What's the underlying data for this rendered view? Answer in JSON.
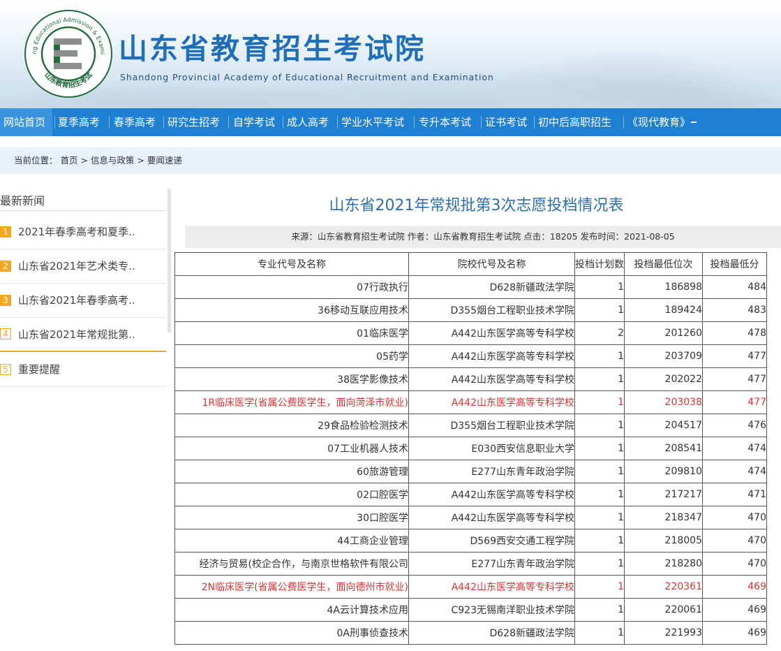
{
  "header": {
    "title": "山东省教育招生考试院",
    "subtitle": "Shandong Provincial Academy of Educational Recruitment and Examination",
    "logo": {
      "ring_text_en": "Shandong Educational Admission & Examinations",
      "ring_text_cn": "山东教育招生考试",
      "letter": "E",
      "icon": "academy-seal-logo"
    }
  },
  "nav": {
    "items": [
      {
        "label": "网站首页",
        "active": true
      },
      {
        "label": "夏季高考"
      },
      {
        "label": "春季高考"
      },
      {
        "label": "研究生招考"
      },
      {
        "label": "自学考试"
      },
      {
        "label": "成人高考"
      },
      {
        "label": "学业水平考试"
      },
      {
        "label": "专升本考试"
      },
      {
        "label": "证书考试"
      },
      {
        "label": "初中后高职招生"
      },
      {
        "label": "《现代教育》"
      }
    ]
  },
  "breadcrumb": "当前位置： 首页 > 信息与政策 > 要闻速递",
  "sidebar": {
    "title": "最新新闻",
    "items": [
      {
        "num": "1",
        "label": "2021年春季高考和夏季.."
      },
      {
        "num": "2",
        "label": "山东省2021年艺术类专.."
      },
      {
        "num": "3",
        "label": "山东省2021年春季高考.."
      },
      {
        "num": "4",
        "label": "山东省2021年常规批第.."
      },
      {
        "num": "5",
        "label": "重要提醒"
      }
    ]
  },
  "article": {
    "title": "山东省2021年常规批第3次志愿投档情况表",
    "meta": "来源：山东省教育招生考试院 作者：山东省教育招生考试院 点击：18205 发布时间：2021-08-05"
  },
  "table": {
    "headers": [
      "专业代号及名称",
      "院校代号及名称",
      "投档计划数",
      "投档最低位次",
      "投档最低分"
    ],
    "rows": [
      {
        "cells": [
          "07行政执行",
          "D628新疆政法学院",
          "1",
          "186898",
          "484"
        ]
      },
      {
        "cells": [
          "36移动互联应用技术",
          "D355烟台工程职业技术学院",
          "1",
          "189424",
          "483"
        ]
      },
      {
        "cells": [
          "01临床医学",
          "A442山东医学高等专科学校",
          "2",
          "201260",
          "478"
        ]
      },
      {
        "cells": [
          "05药学",
          "A442山东医学高等专科学校",
          "1",
          "203709",
          "477"
        ]
      },
      {
        "cells": [
          "38医学影像技术",
          "A442山东医学高等专科学校",
          "1",
          "202022",
          "477"
        ]
      },
      {
        "cells": [
          "1R临床医学(省属公费医学生，面向菏泽市就业)",
          "A442山东医学高等专科学校",
          "1",
          "203038",
          "477"
        ],
        "highlight": true
      },
      {
        "cells": [
          "29食品检验检测技术",
          "D355烟台工程职业技术学院",
          "1",
          "204517",
          "476"
        ]
      },
      {
        "cells": [
          "07工业机器人技术",
          "E030西安信息职业大学",
          "1",
          "208541",
          "474"
        ]
      },
      {
        "cells": [
          "60旅游管理",
          "E277山东青年政治学院",
          "1",
          "209810",
          "474"
        ]
      },
      {
        "cells": [
          "02口腔医学",
          "A442山东医学高等专科学校",
          "1",
          "217217",
          "471"
        ]
      },
      {
        "cells": [
          "30口腔医学",
          "A442山东医学高等专科学校",
          "1",
          "218347",
          "470"
        ]
      },
      {
        "cells": [
          "44工商企业管理",
          "D569西安交通工程学院",
          "1",
          "218005",
          "470"
        ]
      },
      {
        "cells": [
          "经济与贸易(校企合作，与南京世格软件有限公司",
          "E277山东青年政治学院",
          "1",
          "218280",
          "470"
        ]
      },
      {
        "cells": [
          "2N临床医学(省属公费医学生，面向德州市就业)",
          "A442山东医学高等专科学校",
          "1",
          "220361",
          "469"
        ],
        "highlight": true
      },
      {
        "cells": [
          "4A云计算技术应用",
          "C923无锡南洋职业技术学院",
          "1",
          "220061",
          "469"
        ]
      },
      {
        "cells": [
          "0A刑事侦查技术",
          "D628新疆政法学院",
          "1",
          "221993",
          "469"
        ]
      }
    ]
  },
  "colors": {
    "nav_bg": "#1f7fd0",
    "title_blue": "#2a6fb0",
    "highlight_red": "#d33",
    "accent_orange": "#f5a623"
  }
}
